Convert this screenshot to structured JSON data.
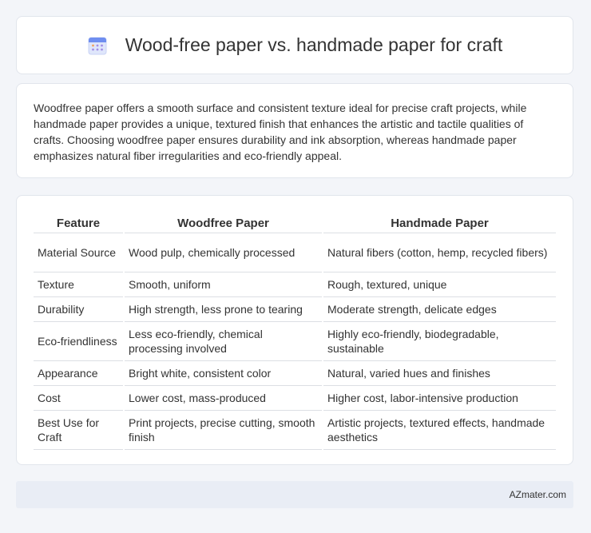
{
  "header": {
    "title": "Wood-free paper vs. handmade paper for craft",
    "icon": "calendar-icon"
  },
  "intro": {
    "text": "Woodfree paper offers a smooth surface and consistent texture ideal for precise craft projects, while handmade paper provides a unique, textured finish that enhances the artistic and tactile qualities of crafts. Choosing woodfree paper ensures durability and ink absorption, whereas handmade paper emphasizes natural fiber irregularities and eco-friendly appeal."
  },
  "table": {
    "headers": [
      "Feature",
      "Woodfree Paper",
      "Handmade Paper"
    ],
    "rows": [
      [
        "Material Source",
        "Wood pulp, chemically processed",
        "Natural fibers (cotton, hemp, recycled fibers)"
      ],
      [
        "Texture",
        "Smooth, uniform",
        "Rough, textured, unique"
      ],
      [
        "Durability",
        "High strength, less prone to tearing",
        "Moderate strength, delicate edges"
      ],
      [
        "Eco-friendliness",
        "Less eco-friendly, chemical processing involved",
        "Highly eco-friendly, biodegradable, sustainable"
      ],
      [
        "Appearance",
        "Bright white, consistent color",
        "Natural, varied hues and finishes"
      ],
      [
        "Cost",
        "Lower cost, mass-produced",
        "Higher cost, labor-intensive production"
      ],
      [
        "Best Use for Craft",
        "Print projects, precise cutting, smooth finish",
        "Artistic projects, textured effects, handmade aesthetics"
      ]
    ]
  },
  "footer": {
    "brand": "AZmater.com"
  }
}
